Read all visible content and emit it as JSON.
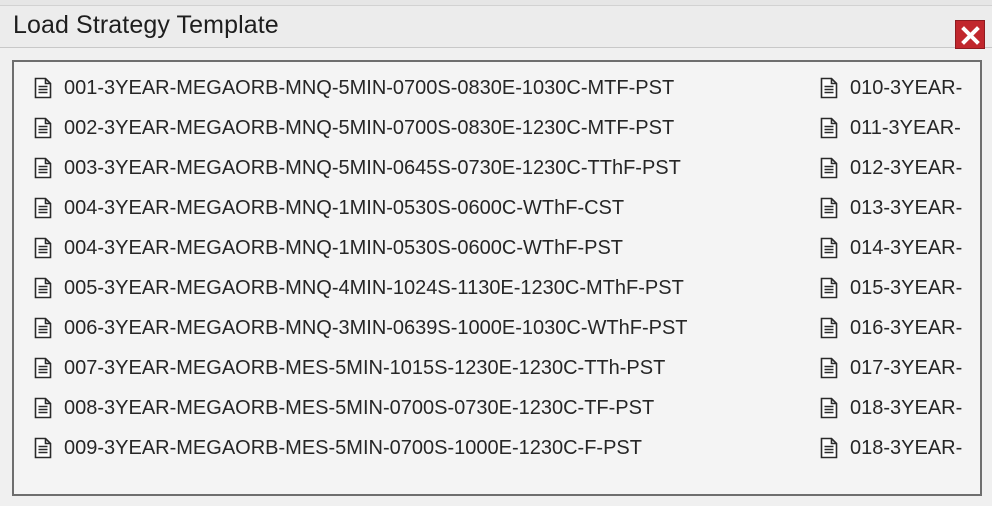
{
  "window": {
    "title": "Load Strategy Template",
    "close_icon": "close-icon",
    "close_color": "#c1272d"
  },
  "list": {
    "item_icon": "document-icon",
    "column1": [
      "001-3YEAR-MEGAORB-MNQ-5MIN-0700S-0830E-1030C-MTF-PST",
      "002-3YEAR-MEGAORB-MNQ-5MIN-0700S-0830E-1230C-MTF-PST",
      "003-3YEAR-MEGAORB-MNQ-5MIN-0645S-0730E-1230C-TThF-PST",
      "004-3YEAR-MEGAORB-MNQ-1MIN-0530S-0600C-WThF-CST",
      "004-3YEAR-MEGAORB-MNQ-1MIN-0530S-0600C-WThF-PST",
      "005-3YEAR-MEGAORB-MNQ-4MIN-1024S-1130E-1230C-MThF-PST",
      "006-3YEAR-MEGAORB-MNQ-3MIN-0639S-1000E-1030C-WThF-PST",
      "007-3YEAR-MEGAORB-MES-5MIN-1015S-1230E-1230C-TTh-PST",
      "008-3YEAR-MEGAORB-MES-5MIN-0700S-0730E-1230C-TF-PST",
      "009-3YEAR-MEGAORB-MES-5MIN-0700S-1000E-1230C-F-PST"
    ],
    "column2": [
      "010-3YEAR-",
      "011-3YEAR-",
      "012-3YEAR-",
      "013-3YEAR-",
      "014-3YEAR-",
      "015-3YEAR-",
      "016-3YEAR-",
      "017-3YEAR-",
      "018-3YEAR-",
      "018-3YEAR-"
    ]
  }
}
